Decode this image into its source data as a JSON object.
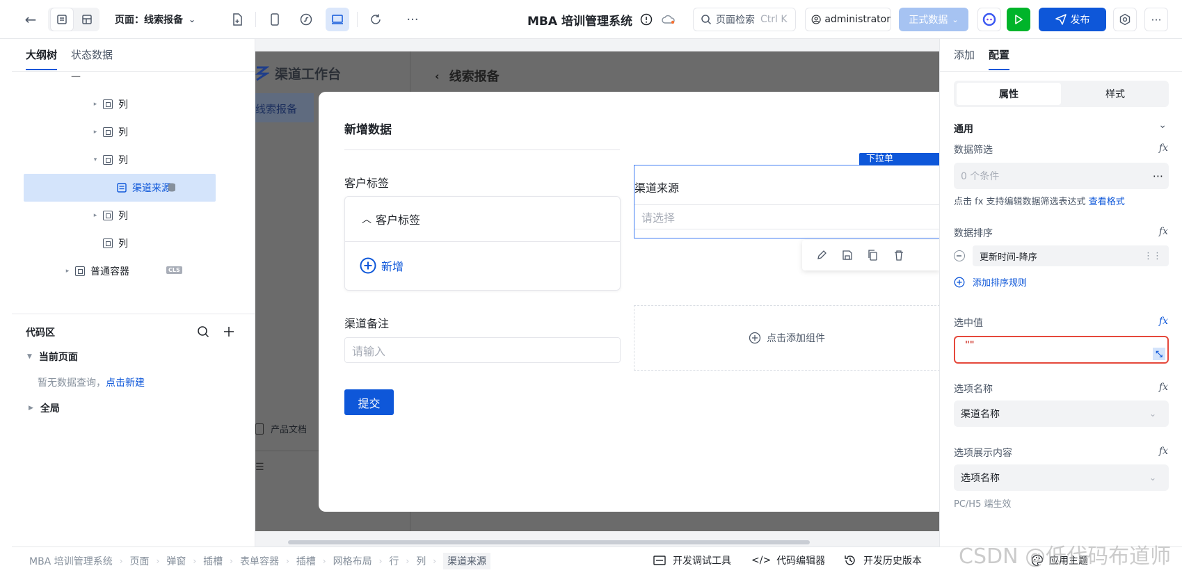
{
  "topbar": {
    "page_label": "页面：线索报备",
    "app_title": "MBA 培训管理系统",
    "search_placeholder": "页面检索",
    "search_shortcut": "Ctrl K",
    "user": "administrator",
    "env": "正式数据",
    "publish": "发布"
  },
  "left": {
    "tab_outline": "大纲树",
    "tab_state": "状态数据",
    "tree": [
      {
        "label": "—",
        "caret": "",
        "icon": "none",
        "indent": 0
      },
      {
        "label": "列",
        "caret": "▸",
        "icon": "box",
        "indent": 1
      },
      {
        "label": "列",
        "caret": "▸",
        "icon": "box",
        "indent": 1
      },
      {
        "label": "列",
        "caret": "▾",
        "icon": "box",
        "indent": 1
      },
      {
        "label": "渠道来源",
        "caret": "",
        "icon": "form",
        "indent": 2,
        "selected": true
      },
      {
        "label": "列",
        "caret": "▸",
        "icon": "box",
        "indent": 1
      },
      {
        "label": "列",
        "caret": "",
        "icon": "box",
        "indent": 1
      },
      {
        "label": "普通容器",
        "caret": "▸",
        "icon": "box",
        "indent": 0,
        "badge": "CLS"
      }
    ],
    "code_title": "代码区",
    "current_page": "当前页面",
    "no_data": "暂无数据查询，",
    "create_link": "点击新建",
    "global": "全局"
  },
  "canvas": {
    "bg_title": "渠道工作台",
    "bg_menu": "线索报备",
    "bg_header": "线索报备",
    "bg_doc": "产品文档",
    "modal": {
      "title": "新增数据",
      "customer_tag_label": "客户标签",
      "customer_tag_group": "客户标签",
      "add_new": "新增",
      "channel_source_label": "渠道来源",
      "channel_source_placeholder": "请选择",
      "badge": "下拉单",
      "channel_note_label": "渠道备注",
      "channel_note_placeholder": "请输入",
      "add_component": "点击添加组件",
      "submit": "提交"
    }
  },
  "right": {
    "tab_add": "添加",
    "tab_config": "配置",
    "seg_props": "属性",
    "seg_style": "样式",
    "general": "通用",
    "filter_label": "数据筛选",
    "filter_value": "0 个条件",
    "filter_hint": "点击 fx 支持编辑数据筛选表达式",
    "filter_hint_link": "查看格式",
    "sort_label": "数据排序",
    "sort_value": "更新时间-降序",
    "add_sort": "添加排序规则",
    "selected_label": "选中值",
    "selected_value": "\"\"",
    "option_name_label": "选项名称",
    "option_name_value": "渠道名称",
    "option_display_label": "选项展示内容",
    "option_display_value": "选项名称",
    "pc_h5": "PC/H5 端生效"
  },
  "statusbar": {
    "crumbs": [
      "MBA 培训管理系统",
      "页面",
      "弹窗",
      "插槽",
      "表单容器",
      "插槽",
      "网格布局",
      "行",
      "列",
      "渠道来源"
    ],
    "debug": "开发调试工具",
    "code_editor": "代码编辑器",
    "history": "开发历史版本",
    "theme": "应用主题"
  },
  "watermark": "CSDN @低代码布道师",
  "colors": {
    "primary": "#0e57d9",
    "selected_bg": "#d4e4fb",
    "error": "#e5483b",
    "green": "#00b42a"
  }
}
